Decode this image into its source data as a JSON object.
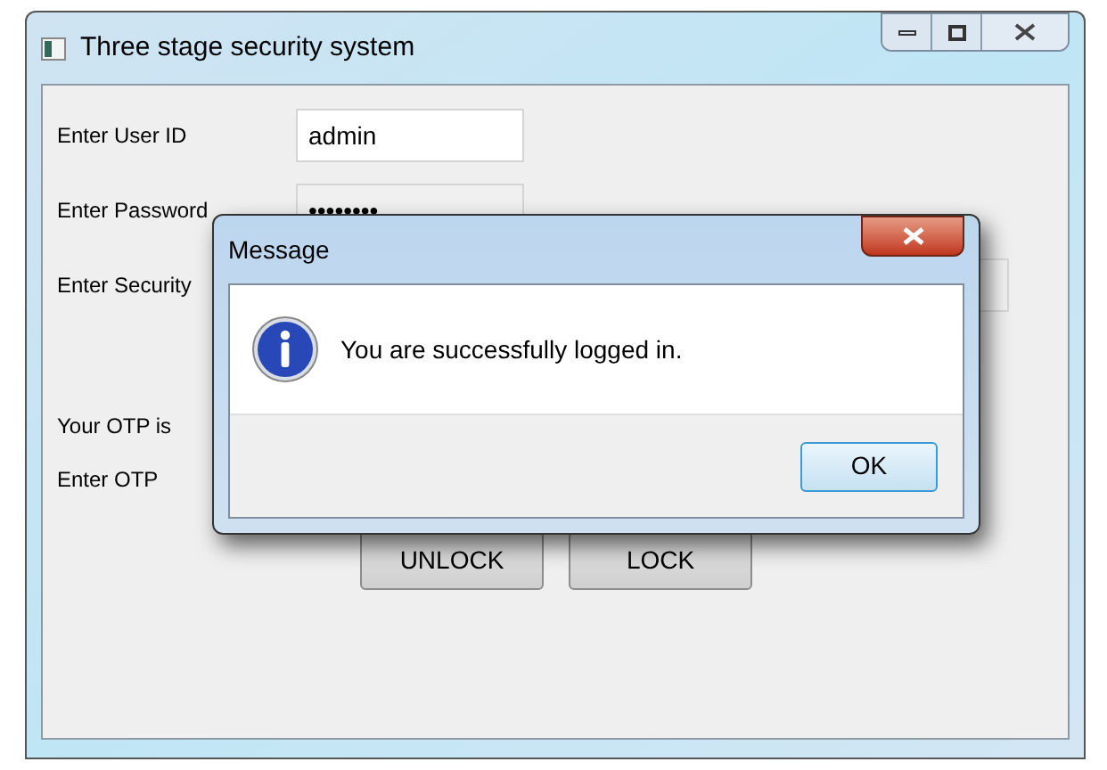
{
  "window": {
    "title": "Three stage security system"
  },
  "form": {
    "user_id_label": "Enter User ID",
    "user_id_value": "admin",
    "password_label": "Enter Password",
    "password_value": "••••••••",
    "security_label": "Enter Security",
    "otp_info": "Your OTP is",
    "otp_label": "Enter OTP"
  },
  "buttons": [
    "UNLOCK",
    "LOCK"
  ],
  "dialog": {
    "title": "Message",
    "message": "You are successfully logged in.",
    "button": "OK"
  }
}
